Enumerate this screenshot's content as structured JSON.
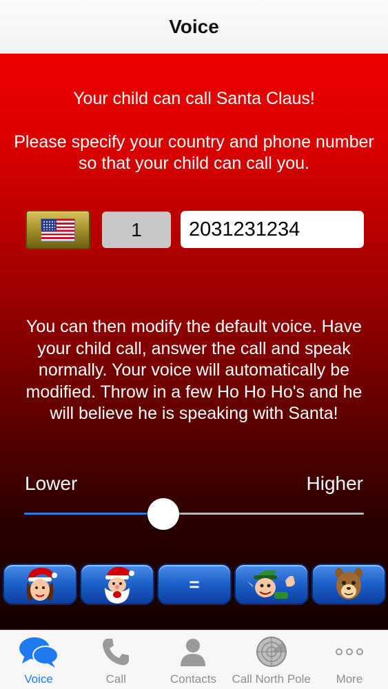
{
  "navbar": {
    "title": "Voice"
  },
  "intro": {
    "line1": "Your child can call Santa Claus!",
    "line2": "Please specify your country and phone number so that your child can call you."
  },
  "phone": {
    "country_flag": "us-flag-icon",
    "country_code": "1",
    "number": "2031231234"
  },
  "description": "You can then modify the default voice. Have your child call, answer the call and speak normally. Your voice will automatically be modified. Throw in a few Ho Ho Ho's and he will believe he is speaking with Santa!",
  "pitch": {
    "lower_label": "Lower",
    "higher_label": "Higher",
    "value": 0.41
  },
  "voice_presets": [
    {
      "icon": "mrs-claus-icon"
    },
    {
      "icon": "santa-icon"
    },
    {
      "label": "="
    },
    {
      "icon": "elf-icon"
    },
    {
      "icon": "chipmunk-icon"
    }
  ],
  "tabs": [
    {
      "label": "Voice",
      "icon": "speech-bubbles-icon",
      "active": true
    },
    {
      "label": "Call",
      "icon": "phone-handset-icon"
    },
    {
      "label": "Contacts",
      "icon": "person-icon"
    },
    {
      "label": "Call North Pole",
      "icon": "radar-icon"
    },
    {
      "label": "More",
      "icon": "more-dots-icon"
    }
  ],
  "colors": {
    "accent": "#1e7bf0",
    "background_red": "#f00000",
    "button_blue": "#1d5fc9"
  }
}
